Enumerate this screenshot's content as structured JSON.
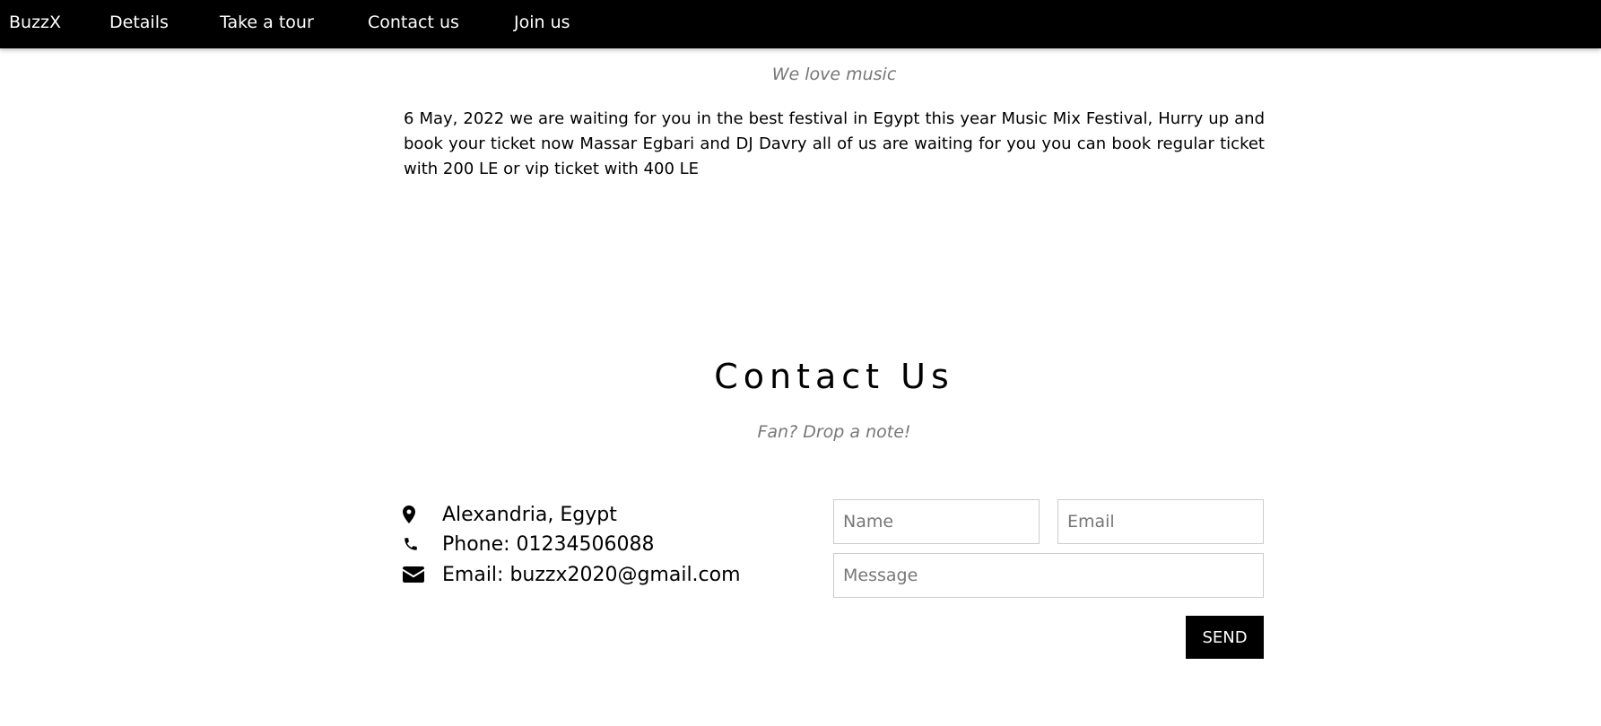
{
  "nav": {
    "brand": "BuzzX",
    "items": [
      {
        "label": "Details"
      },
      {
        "label": "Take a tour"
      },
      {
        "label": "Contact us"
      },
      {
        "label": "Join us"
      }
    ]
  },
  "about": {
    "tagline": "We love music",
    "body": "6 May, 2022 we are waiting for you in the best festival in Egypt this year Music Mix Festival, Hurry up and book your ticket now Massar Egbari and DJ Davry all of us are waiting for you you can book regular ticket with 200 LE or vip ticket with 400 LE"
  },
  "contact": {
    "title": "Contact Us",
    "subtitle": "Fan? Drop a note!",
    "info": [
      {
        "icon": "map-marker-icon",
        "text": "Alexandria, Egypt"
      },
      {
        "icon": "phone-icon",
        "text": "Phone: 01234506088"
      },
      {
        "icon": "envelope-icon",
        "text": "Email: buzzx2020@gmail.com"
      }
    ],
    "form": {
      "name_placeholder": "Name",
      "email_placeholder": "Email",
      "message_placeholder": "Message",
      "send_label": "SEND"
    }
  }
}
